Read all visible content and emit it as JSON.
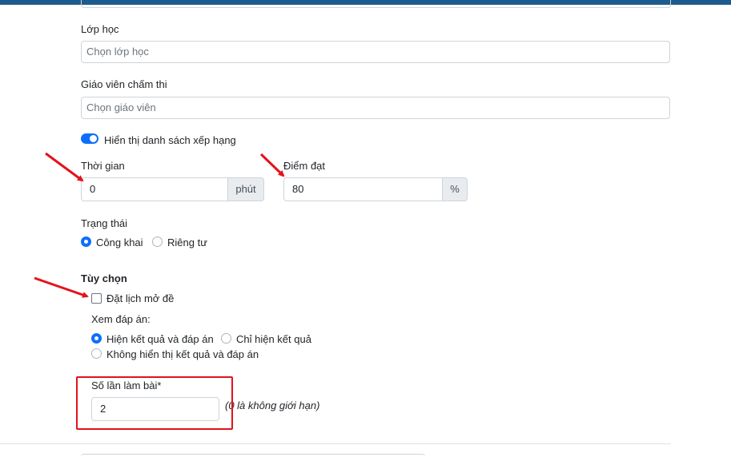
{
  "form": {
    "class_label": "Lớp học",
    "class_placeholder": "Chọn lớp học",
    "teacher_label": "Giáo viên chấm thi",
    "teacher_placeholder": "Chọn giáo viên",
    "ranking_toggle_label": "Hiển thị danh sách xếp hạng",
    "ranking_toggle_on": true,
    "time_label": "Thời gian",
    "time_value": "0",
    "time_unit": "phút",
    "pass_score_label": "Điểm đạt",
    "pass_score_value": "80",
    "pass_score_unit": "%",
    "status_label": "Trạng thái",
    "status_options": [
      "Công khai",
      "Riêng tư"
    ],
    "status_selected": "Công khai",
    "options_heading": "Tùy chọn",
    "schedule_checkbox_label": "Đặt lịch mở đề",
    "schedule_checked": false,
    "view_answers_label": "Xem đáp án:",
    "view_answers_options": [
      "Hiện kết quả và đáp án",
      "Chỉ hiện kết quả",
      "Không hiển thị kết quả và đáp án"
    ],
    "view_answers_selected": "Hiện kết quả và đáp án",
    "attempts_label": "Số lần làm bài*",
    "attempts_value": "2",
    "attempts_note": "(0 là không giới hạn)"
  },
  "colors": {
    "accent": "#0d6efd",
    "header_bar": "#1d5b8f",
    "annotation_red": "#e4121b"
  }
}
